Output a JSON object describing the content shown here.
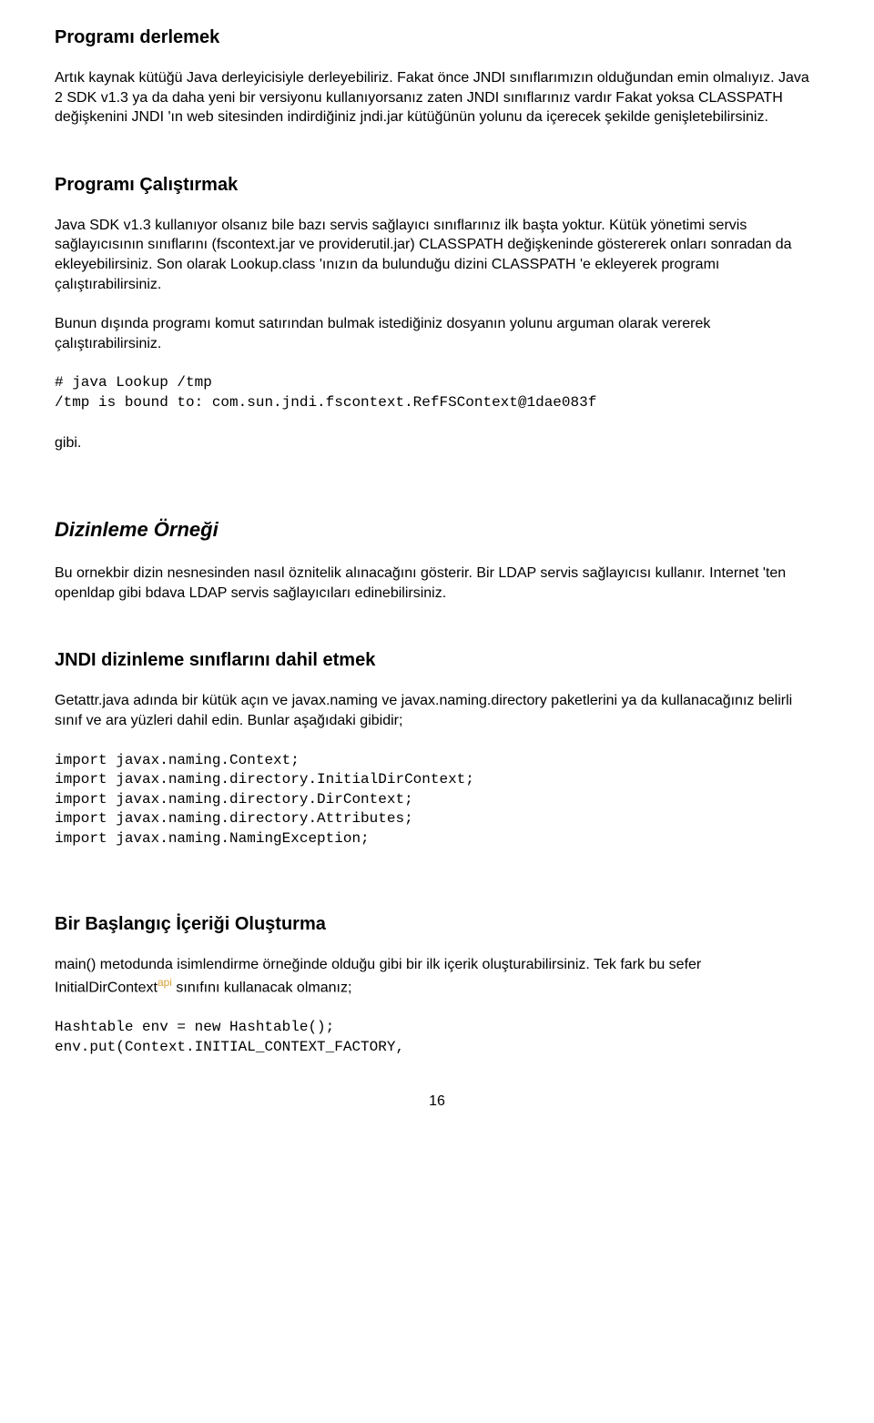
{
  "h1": "Programı derlemek",
  "p1": "Artık kaynak kütüğü Java derleyicisiyle derleyebiliriz. Fakat önce JNDI sınıflarımızın olduğundan emin olmalıyız. Java 2 SDK v1.3 ya da daha yeni bir versiyonu kullanıyorsanız zaten JNDI sınıflarınız vardır Fakat yoksa CLASSPATH değişkenini JNDI 'ın web sitesinden indirdiğiniz jndi.jar kütüğünün yolunu da içerecek şekilde genişletebilirsiniz.",
  "h2": "Programı Çalıştırmak",
  "p2": "Java SDK v1.3 kullanıyor olsanız bile bazı servis sağlayıcı sınıflarınız ilk başta yoktur. Kütük yönetimi servis sağlayıcısının sınıflarını (fscontext.jar ve providerutil.jar) CLASSPATH değişkeninde göstererek onları sonradan da ekleyebilirsiniz. Son olarak Lookup.class 'ınızın da bulunduğu dizini CLASSPATH 'e ekleyerek programı çalıştırabilirsiniz.",
  "p3": "Bunun dışında programı komut satırından bulmak istediğiniz dosyanın yolunu arguman olarak vererek çalıştırabilirsiniz.",
  "code1": "# java Lookup /tmp\n/tmp is bound to: com.sun.jndi.fscontext.RefFSContext@1dae083f",
  "p4": "gibi.",
  "h3": "Dizinleme Örneği",
  "p5": "Bu ornekbir dizin nesnesinden nasıl öznitelik alınacağını gösterir. Bir LDAP servis sağlayıcısı kullanır. Internet 'ten openldap gibi bdava LDAP servis sağlayıcıları edinebilirsiniz.",
  "h4": "JNDI dizinleme sınıflarını dahil etmek",
  "p6": "Getattr.java adında bir kütük açın ve javax.naming ve javax.naming.directory paketlerini ya da  kullanacağınız belirli sınıf ve ara yüzleri dahil edin. Bunlar aşağıdaki gibidir;",
  "code2": "import javax.naming.Context;\nimport javax.naming.directory.InitialDirContext;\nimport javax.naming.directory.DirContext;\nimport javax.naming.directory.Attributes;\nimport javax.naming.NamingException;",
  "h5": "Bir Başlangıç İçeriği Oluşturma",
  "p7a": "main() metodunda isimlendirme örneğinde olduğu gibi bir ilk içerik oluşturabilirsiniz. Tek fark bu sefer InitialDirContext",
  "p7api": "api",
  "p7b": " sınıfını kullanacak olmanız;",
  "code3": "Hashtable env = new Hashtable();\nenv.put(Context.INITIAL_CONTEXT_FACTORY,",
  "pagenum": "16"
}
